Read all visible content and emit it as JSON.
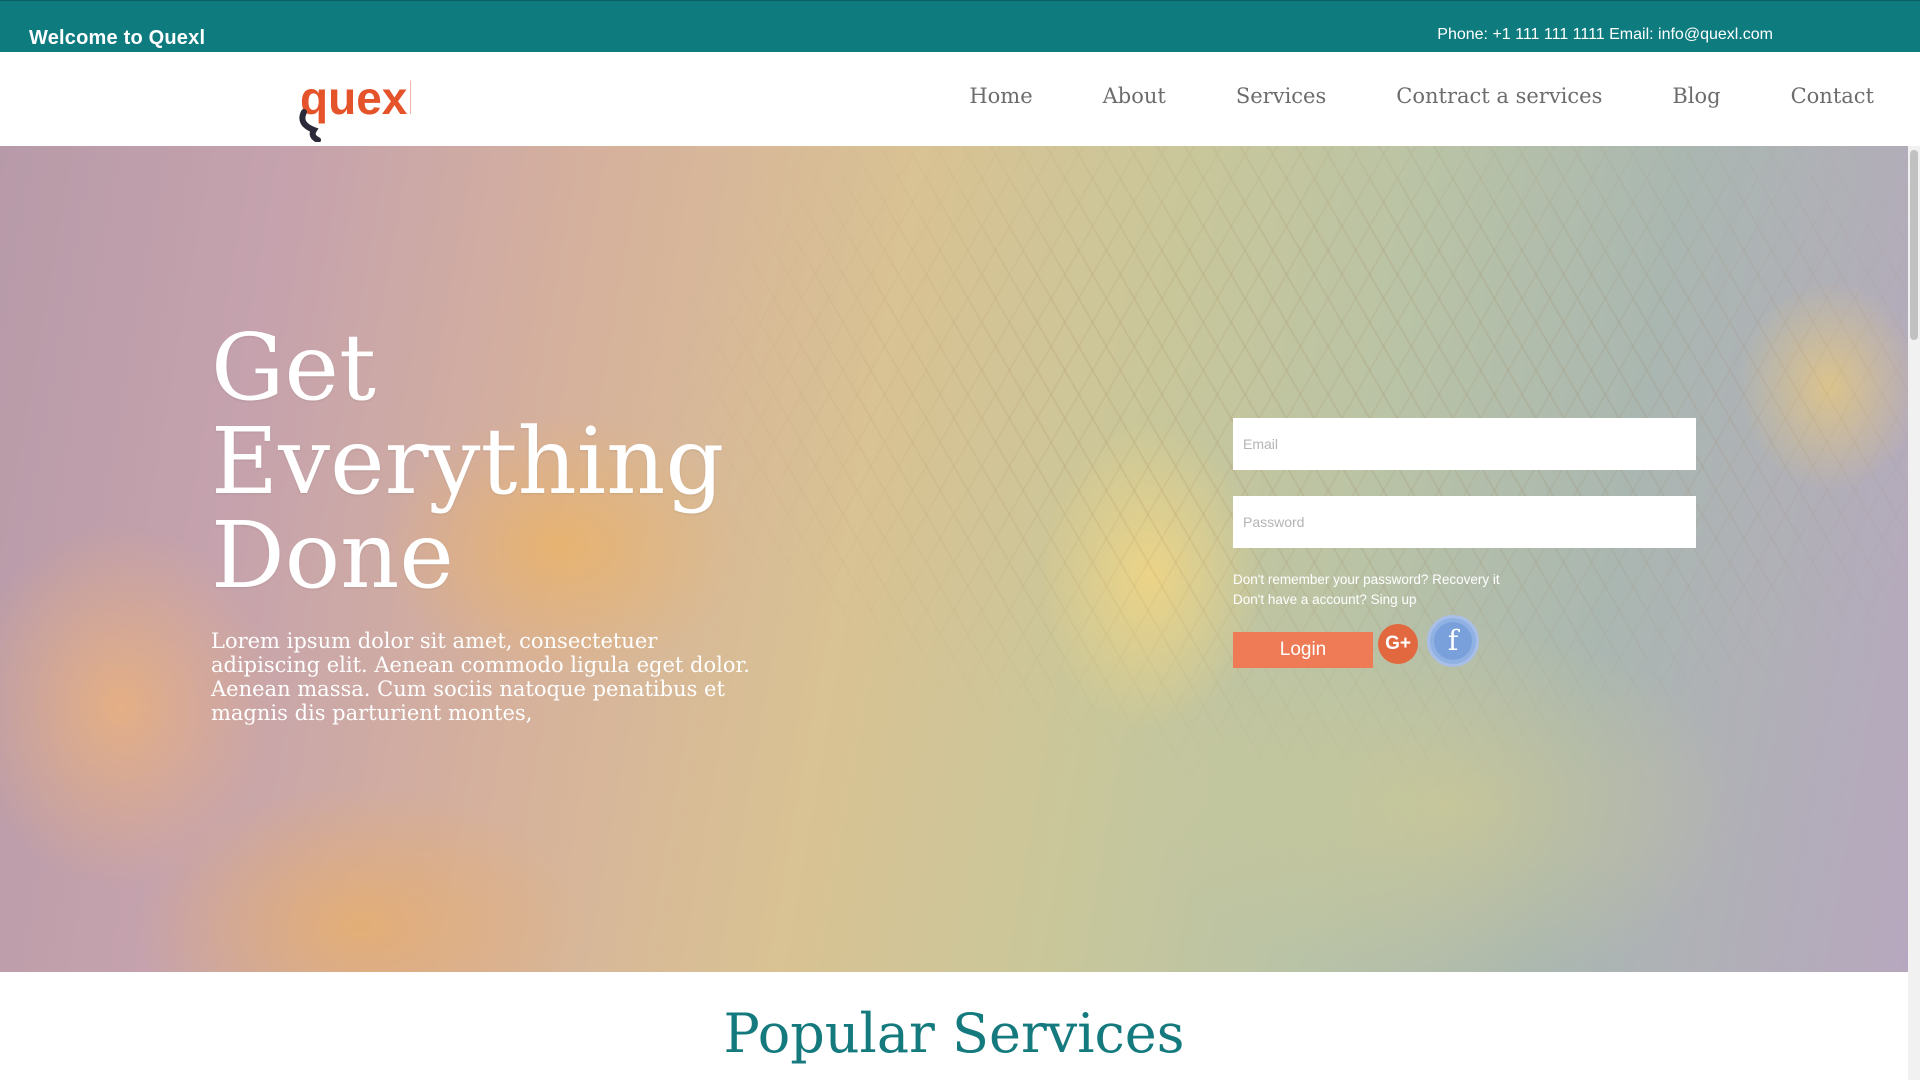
{
  "topbar": {
    "welcome": "Welcome to Quexl",
    "contact": "Phone: +1 111 111 1111 Email: info@quexl.com"
  },
  "header": {
    "logo_text": "quexl",
    "nav": [
      "Home",
      "About",
      "Services",
      "Contract a services",
      "Blog",
      "Contact"
    ]
  },
  "hero": {
    "title": "Get\nEverything\nDone",
    "text": "Lorem ipsum dolor sit amet, consectetuer adipiscing elit. Aenean commodo ligula eget dolor. Aenean massa. Cum sociis natoque penatibus et magnis dis parturient montes,",
    "login": {
      "email_placeholder": "Email",
      "password_placeholder": "Password",
      "recover_text": "Don't remember your password? Recovery it",
      "signup_text": "Don't have a account? Sing up",
      "button": "Login",
      "google_label": "G+",
      "facebook_label": "f"
    }
  },
  "section": {
    "title": "Popular Services"
  },
  "colors": {
    "teal": "#0e7b7f",
    "accent_orange": "#ee7b55",
    "nav_text": "#6c6c6c"
  }
}
